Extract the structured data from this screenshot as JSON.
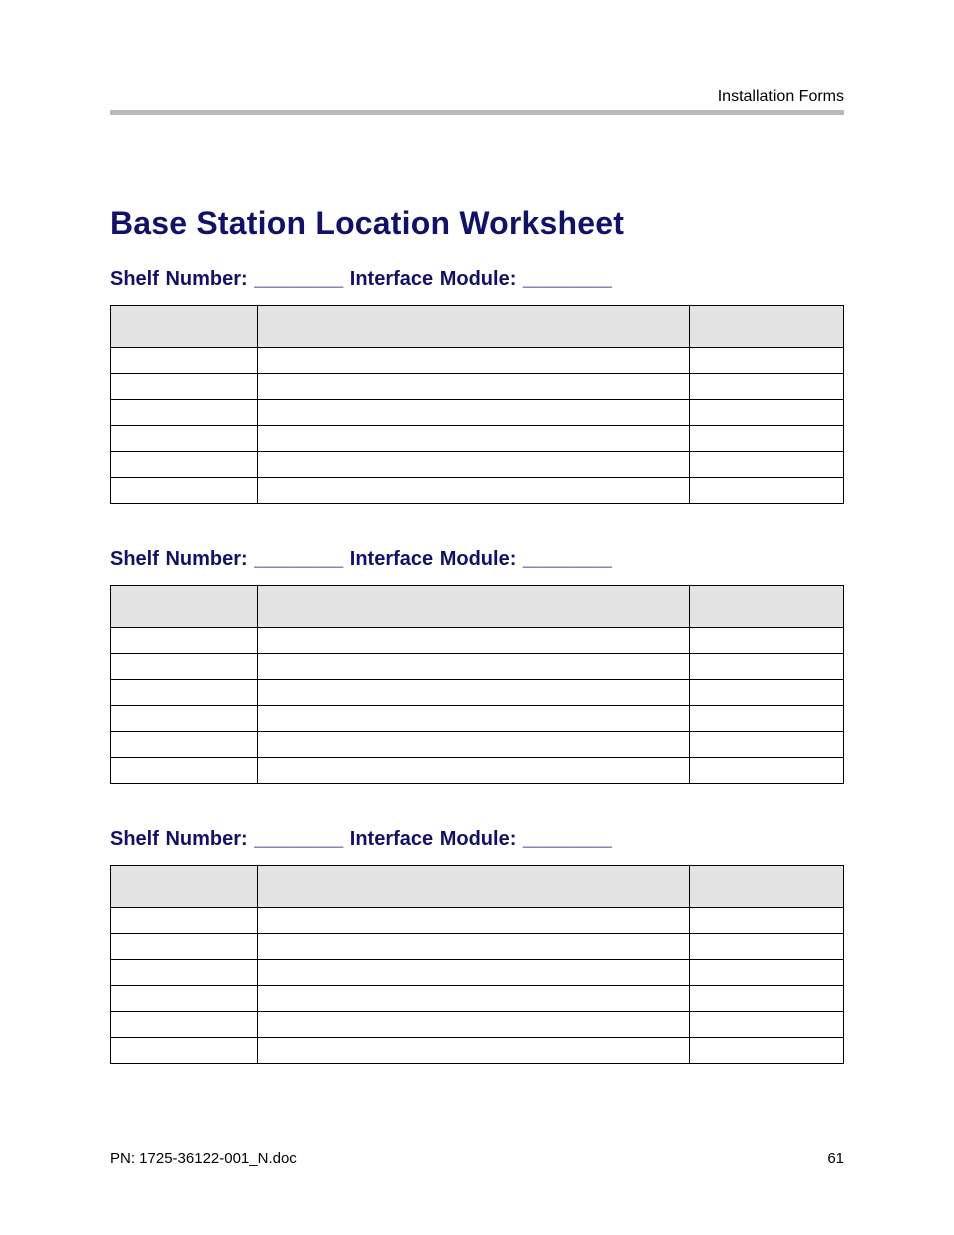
{
  "header": {
    "label": "Installation Forms"
  },
  "title": "Base Station Location Worksheet",
  "section_label": "Shelf Number: ________  Interface Module: ________",
  "sections": [
    {
      "rows": 6
    },
    {
      "rows": 6
    },
    {
      "rows": 6
    }
  ],
  "footer": {
    "pn": "PN: 1725-36122-001_N.doc",
    "page": "61"
  }
}
